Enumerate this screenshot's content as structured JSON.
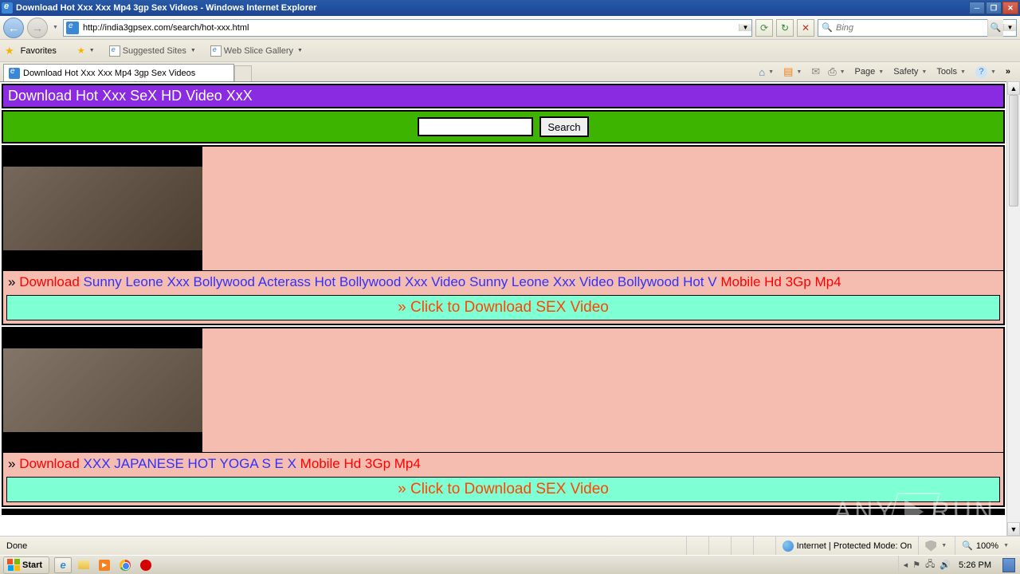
{
  "window": {
    "title": "Download Hot Xxx Xxx Mp4 3gp Sex Videos - Windows Internet Explorer"
  },
  "nav": {
    "url": "http://india3gpsex.com/search/hot-xxx.html",
    "search_placeholder": "Bing"
  },
  "favorites": {
    "label": "Favorites",
    "suggested": "Suggested Sites",
    "webslice": "Web Slice Gallery"
  },
  "tab": {
    "title": "Download Hot Xxx Xxx Mp4 3gp Sex Videos"
  },
  "cmd": {
    "page": "Page",
    "safety": "Safety",
    "tools": "Tools"
  },
  "page": {
    "header": "Download Hot Xxx SeX HD Video XxX",
    "search_btn": "Search",
    "videos": [
      {
        "download": "Download",
        "title": "Sunny Leone Xxx Bollywood Acterass Hot Bollywood Xxx Video Sunny Leone Xxx Video Bollywood Hot V",
        "suffix": "Mobile Hd 3Gp Mp4"
      },
      {
        "download": "Download",
        "title": "XXX JAPANESE HOT YOGA S E X",
        "suffix": "Mobile Hd 3Gp Mp4"
      }
    ],
    "download_banner": "» Click to Download SEX Video"
  },
  "status": {
    "left": "Done",
    "zone": "Internet | Protected Mode: On",
    "zoom": "100%"
  },
  "taskbar": {
    "start": "Start",
    "clock": "5:26 PM"
  },
  "watermark": {
    "text1": "ANY",
    "text2": "RUN"
  }
}
